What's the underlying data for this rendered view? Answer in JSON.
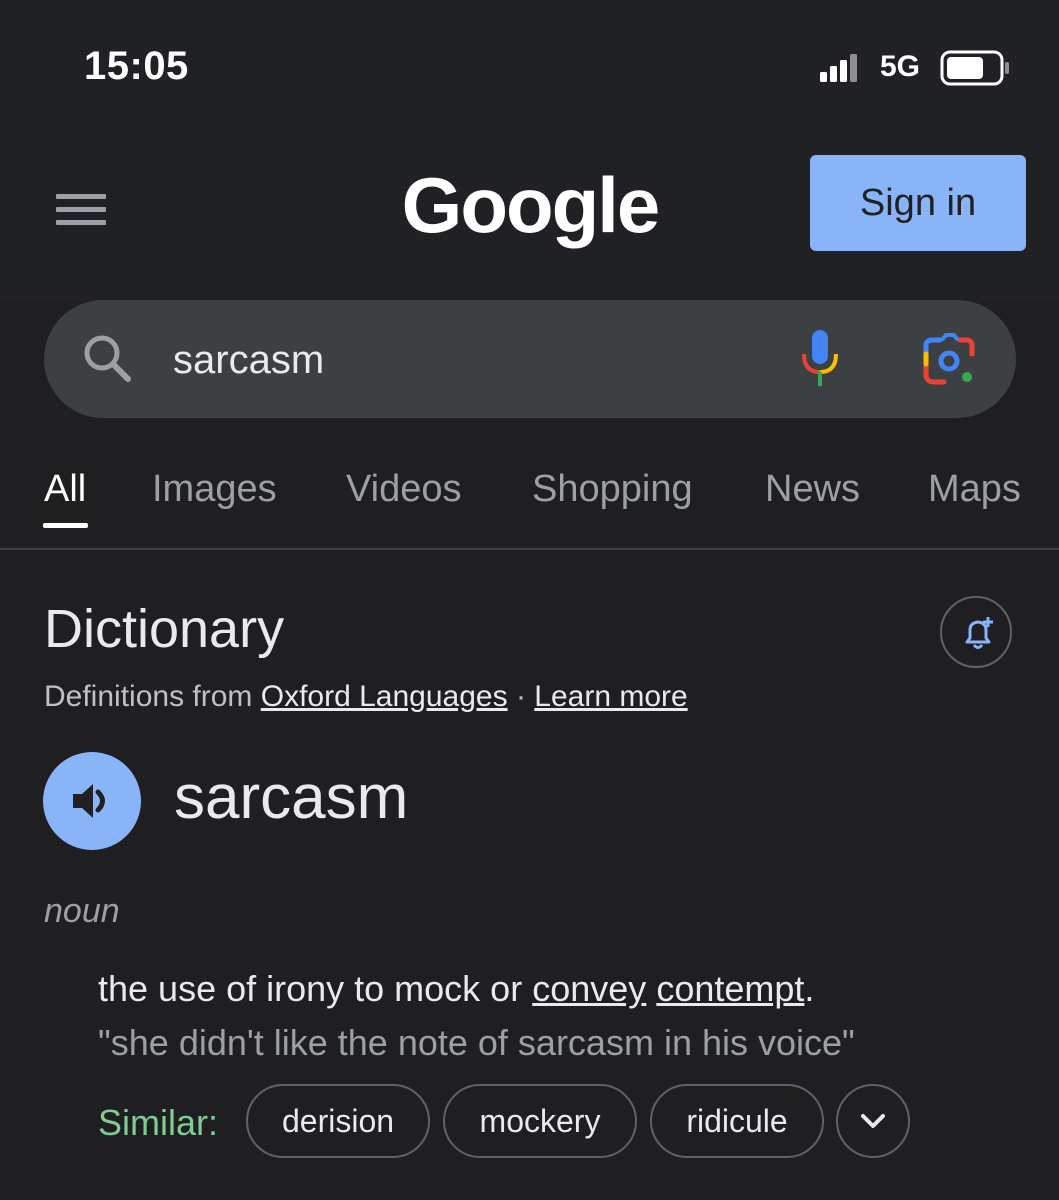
{
  "status_bar": {
    "time": "15:05",
    "network": "5G"
  },
  "header": {
    "logo": "Google",
    "sign_in": "Sign in"
  },
  "search": {
    "value": "sarcasm"
  },
  "tabs": [
    {
      "label": "All",
      "active": true
    },
    {
      "label": "Images",
      "active": false
    },
    {
      "label": "Videos",
      "active": false
    },
    {
      "label": "Shopping",
      "active": false
    },
    {
      "label": "News",
      "active": false
    },
    {
      "label": "Maps",
      "active": false
    }
  ],
  "dictionary": {
    "title": "Dictionary",
    "source_prefix": "Definitions from",
    "source_link": "Oxford Languages",
    "separator": "·",
    "learn_more": "Learn more",
    "word": "sarcasm",
    "part_of_speech": "noun",
    "definition_prefix": "the use of irony to mock or",
    "definition_link_1": "convey",
    "definition_link_2": "contempt",
    "definition_suffix": ".",
    "example": "\"she didn't like the note of sarcasm in his voice\"",
    "similar_label": "Similar:",
    "similar": [
      "derision",
      "mockery",
      "ridicule"
    ]
  },
  "colors": {
    "background": "#202124",
    "accent": "#8ab4f8",
    "similar_label": "#81c995"
  }
}
